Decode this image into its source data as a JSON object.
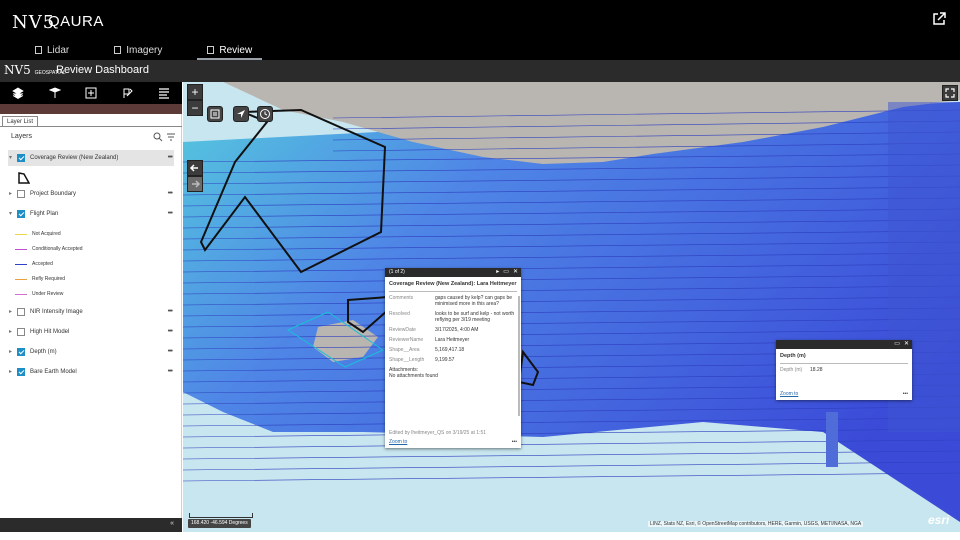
{
  "header": {
    "logo": "NV5",
    "app_title": "QAURA",
    "tabs": [
      {
        "label": "Lidar",
        "active": false
      },
      {
        "label": "Imagery",
        "active": false
      },
      {
        "label": "Review",
        "active": true
      }
    ]
  },
  "dashboard": {
    "logo": "NV5",
    "logo_sub": "GEOSPATIAL",
    "title": "Review Dashboard"
  },
  "toolbar": {
    "icons": [
      "layers-icon",
      "legend-icon",
      "add-data-icon",
      "edit-icon",
      "list-icon"
    ]
  },
  "panel": {
    "tab_label": "Layer List",
    "header": "Layers",
    "collapse_glyph": "«",
    "layers": [
      {
        "name": "Coverage Review (New Zealand)",
        "checked": true,
        "expanded": true
      },
      {
        "name": "Project Boundary",
        "checked": false,
        "expanded": false
      },
      {
        "name": "Flight Plan",
        "checked": true,
        "expanded": true
      },
      {
        "name": "NIR Intensity Image",
        "checked": false,
        "expanded": false
      },
      {
        "name": "High Hit Model",
        "checked": false,
        "expanded": false
      },
      {
        "name": "Depth (m)",
        "checked": true,
        "expanded": false
      },
      {
        "name": "Bare Earth Model",
        "checked": true,
        "expanded": false
      }
    ],
    "flight_plan_legend": [
      {
        "label": "Not Acquired",
        "color": "#e8d84a"
      },
      {
        "label": "Conditionally Accepted",
        "color": "#c04cd0"
      },
      {
        "label": "Accepted",
        "color": "#3040c8"
      },
      {
        "label": "Refly Required",
        "color": "#e8a040"
      },
      {
        "label": "Under Review",
        "color": "#d070d0"
      }
    ]
  },
  "map": {
    "zoom_in": "+",
    "zoom_out": "−",
    "coordinates": "168.420 -46.594 Degrees",
    "attribution": "LINZ, Stats NZ, Esri, © OpenStreetMap contributors, HERE, Garmin, USGS, METI/NASA, NGA",
    "esri_logo": "esri",
    "colors": {
      "land": "#b9b5b0",
      "sea_light": "#c8e6ef",
      "depth_high": "#3b4bd8",
      "depth_mid": "#4f86e6",
      "depth_low": "#55c8de",
      "flight_line": "#2e3fbf",
      "review_poly": "#111111"
    }
  },
  "popup_review": {
    "counter": "(1 of 2)",
    "title": "Coverage Review (New Zealand): Lara Heitmeyer",
    "fields": [
      {
        "key": "Comments",
        "value": "gaps caused by kelp? can gaps be minimised more in this area?"
      },
      {
        "key": "Resolved",
        "value": "looks to be surf and kelp - not worth reflying per 3/19 meeting"
      },
      {
        "key": "ReviewDate",
        "value": "3/17/2025, 4:00 AM"
      },
      {
        "key": "ReviewerName",
        "value": "Lara Heitmeyer"
      },
      {
        "key": "Shape__Area",
        "value": "5,169,417.18"
      },
      {
        "key": "Shape__Length",
        "value": "9,199.57"
      }
    ],
    "attachments_label": "Attachments:",
    "attachments_value": "No attachments found",
    "edited": "Edited by lheitmeyer_QS on 3/19/25 at 1:51",
    "zoom_link": "Zoom to",
    "more": "•••"
  },
  "popup_depth": {
    "title": "Depth (m)",
    "field_key": "Depth (m)",
    "field_value": "18.28",
    "zoom_link": "Zoom to",
    "more": "•••"
  }
}
